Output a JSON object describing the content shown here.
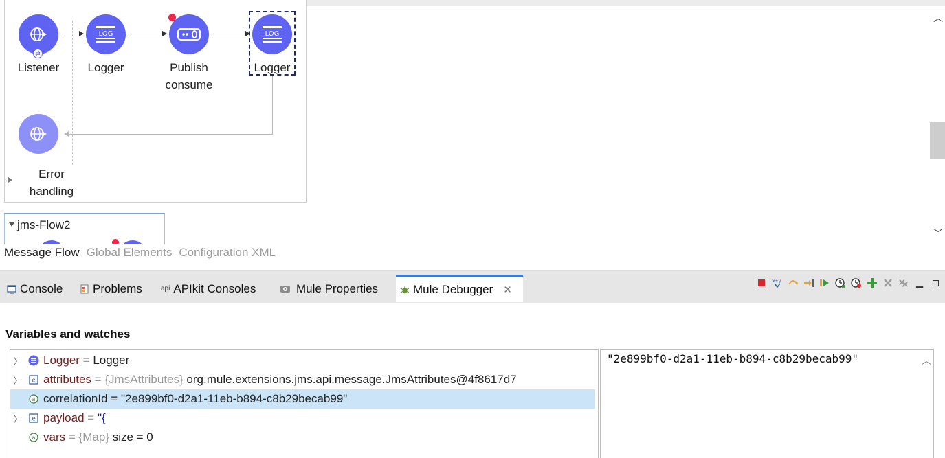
{
  "canvas": {
    "flow1": {
      "nodes": [
        {
          "label": "Listener",
          "icon": "globe-icon"
        },
        {
          "label": "Logger",
          "icon": "log-icon",
          "icon_text": "LOG"
        },
        {
          "label": "Publish\nconsume",
          "icon": "publish-consume-icon"
        },
        {
          "label": "Logger",
          "icon": "log-icon",
          "icon_text": "LOG",
          "selected": true
        }
      ],
      "error_handling": {
        "label": "Error\nhandling",
        "icon": "globe-icon"
      }
    },
    "flow2": {
      "title": "jms-Flow2"
    }
  },
  "editor_tabs": [
    {
      "label": "Message Flow",
      "active": true
    },
    {
      "label": "Global Elements",
      "active": false
    },
    {
      "label": "Configuration XML",
      "active": false
    }
  ],
  "panel_tabs": [
    {
      "label": "Console",
      "icon": "console-icon"
    },
    {
      "label": "Problems",
      "icon": "problems-icon"
    },
    {
      "label": "APIkit Consoles",
      "icon": "api-icon",
      "icon_text": "api"
    },
    {
      "label": "Mule Properties",
      "icon": "properties-icon"
    },
    {
      "label": "Mule Debugger",
      "icon": "debugger-icon",
      "active": true
    }
  ],
  "debugger": {
    "title": "Variables and watches",
    "rows": [
      {
        "name": "Logger",
        "eq": "=",
        "type": "",
        "value": "Logger",
        "expandable": true,
        "icon": "processor-icon"
      },
      {
        "name": "attributes",
        "eq": "=",
        "type": "{JmsAttributes}",
        "value": "org.mule.extensions.jms.api.message.JmsAttributes@4f8617d7",
        "expandable": true,
        "icon": "object-icon"
      },
      {
        "name": "correlationId",
        "eq": "=",
        "type": "",
        "value": "\"2e899bf0-d2a1-11eb-b894-c8b29becab99\"",
        "expandable": false,
        "icon": "attribute-icon",
        "selected": true
      },
      {
        "name": "payload",
        "eq": "=",
        "type": "",
        "value": "\"{",
        "expandable": true,
        "icon": "object-icon",
        "value_color": "blue"
      },
      {
        "name": "vars",
        "eq": "=",
        "type": "{Map}",
        "value": "size = 0",
        "expandable": false,
        "icon": "attribute-icon"
      }
    ],
    "detail_value": "\"2e899bf0-d2a1-11eb-b894-c8b29becab99\""
  },
  "colors": {
    "node": "#5f63f2",
    "accent_tab": "#3a7bd5",
    "selection": "#cce4f7"
  }
}
